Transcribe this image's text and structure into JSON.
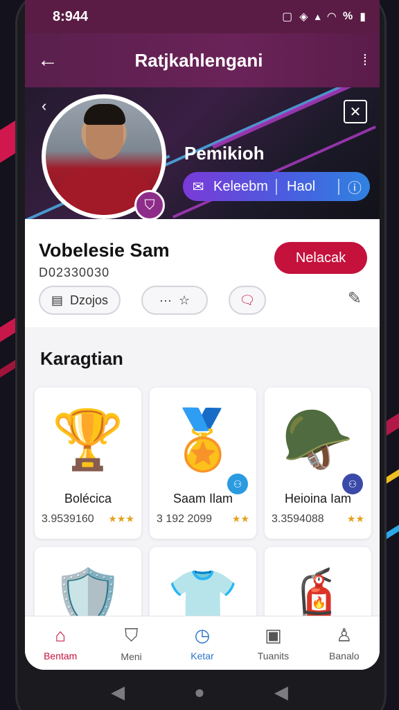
{
  "status_bar": {
    "time": "8:944",
    "battery": "%"
  },
  "app_bar": {
    "back_icon": "arrow-left-icon",
    "title": "Ratjkahlengani",
    "more_icon": "more-options-icon"
  },
  "hero": {
    "name": "Pemikioh",
    "pill": {
      "label_left": "Keleebm",
      "label_right": "Haol"
    }
  },
  "profile": {
    "name": "Vobelesie Sam",
    "id": "D02330030",
    "action_label": "Nelacak",
    "chip_left_label": "Dzojos",
    "chip_dots": "···"
  },
  "section": {
    "title": "Karagtian",
    "items": [
      {
        "name": "Bolécica",
        "value": "3.9539160",
        "icon": "trophy-icon",
        "emoji": "🏆"
      },
      {
        "name": "Saam Ilam",
        "value": "3 192 2099",
        "icon": "medal-icon",
        "emoji": "🏅",
        "corner_color": "#2a9be0"
      },
      {
        "name": "Heioina Iam",
        "value": "3.3594088",
        "icon": "helmet-icon",
        "emoji": "🪖",
        "corner_color": "#3b4aa8"
      },
      {
        "name": "",
        "value": "",
        "icon": "shield-crest-icon",
        "emoji": "🛡️"
      },
      {
        "name": "",
        "value": "",
        "icon": "jersey-icon",
        "emoji": "👕"
      },
      {
        "name": "",
        "value": "",
        "icon": "canister-icon",
        "emoji": "🧯"
      }
    ]
  },
  "bottom_nav": [
    {
      "label": "Bentam",
      "icon": "home-icon",
      "glyph": "⌂"
    },
    {
      "label": "Meni",
      "icon": "shield-icon",
      "glyph": "⛉"
    },
    {
      "label": "Ketar",
      "icon": "clock-icon",
      "glyph": "◷"
    },
    {
      "label": "Tuanits",
      "icon": "scoreboard-icon",
      "glyph": "▣"
    },
    {
      "label": "Banalo",
      "icon": "person-icon",
      "glyph": "♙"
    }
  ],
  "colors": {
    "primary": "#c4123c",
    "appbar": "#5a1c45",
    "accent_blue": "#2d74c8"
  }
}
